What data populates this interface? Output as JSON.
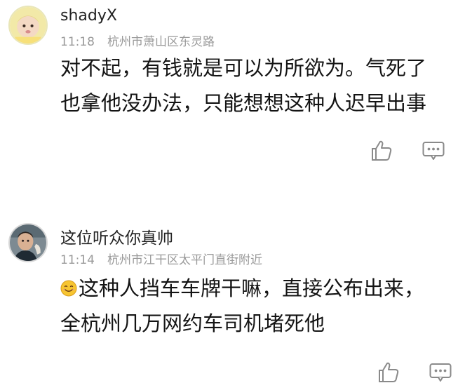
{
  "comments": [
    {
      "username": "shadyX",
      "time": "11:18",
      "location": "杭州市萧山区东灵路",
      "lines": [
        "对不起，有钱就是可以为所欲为。气死了",
        "也拿他没办法，只能想想这种人迟早出事"
      ],
      "avatar_icon": "baby-photo-avatar",
      "like_icon": "thumbs-up-icon",
      "reply_icon": "comment-bubble-icon"
    },
    {
      "username": "这位听众你真帅",
      "time": "11:14",
      "location": "杭州市江干区太平门直街附近",
      "lines": [
        "这种人挡车车牌干嘛，直接公布出来，",
        "全杭州几万网约车司机堵死他"
      ],
      "emoji_icon": "smile-emoji-icon",
      "avatar_icon": "man-photo-avatar",
      "like_icon": "thumbs-up-icon",
      "reply_icon": "comment-bubble-icon"
    }
  ],
  "colors": {
    "username": "#222222",
    "meta": "#9a9a9a",
    "content": "#141414",
    "icon": "#8a8a8a"
  }
}
